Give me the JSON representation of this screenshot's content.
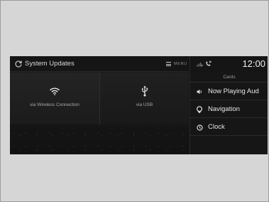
{
  "header": {
    "title": "System Updates",
    "menu_label": "MENU"
  },
  "options": [
    {
      "label": "via Wireless Connection",
      "icon": "wifi-icon"
    },
    {
      "label": "via USB",
      "icon": "usb-icon"
    }
  ],
  "status": {
    "time": "12:00",
    "icons": [
      "signal-muted-icon",
      "phone-disconnected-icon"
    ]
  },
  "cards": {
    "title": "Cards",
    "items": [
      {
        "label": "Now Playing Aud",
        "icon": "speaker-icon"
      },
      {
        "label": "Navigation",
        "icon": "navigation-pin-icon"
      },
      {
        "label": "Clock",
        "icon": "clock-icon"
      }
    ]
  }
}
